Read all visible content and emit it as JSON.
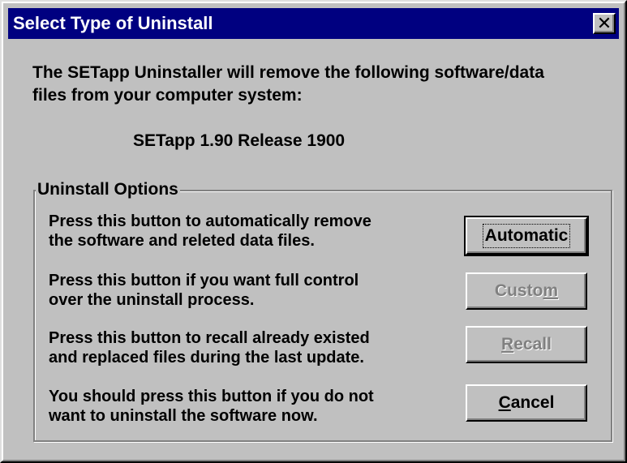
{
  "window": {
    "title": "Select Type of Uninstall",
    "close_glyph": "✕"
  },
  "intro": {
    "line1": "The SETapp Uninstaller will remove the following software/data",
    "line2": "files from your computer system:"
  },
  "product": "SETapp 1.90 Release 1900",
  "group": {
    "legend": "Uninstall Options",
    "options": [
      {
        "desc_line1": "Press this button to automatically remove",
        "desc_line2": "the software and releted data files.",
        "button_label": "Automatic",
        "button_state": "default"
      },
      {
        "desc_line1": "Press this button if you want full control",
        "desc_line2": "over the uninstall process.",
        "button_label_pre": "Custo",
        "button_label_accel": "m",
        "button_label_post": "",
        "button_state": "disabled"
      },
      {
        "desc_line1": "Press this button to recall already existed",
        "desc_line2": "and replaced files during the last update.",
        "button_label_pre": "",
        "button_label_accel": "R",
        "button_label_post": "ecall",
        "button_state": "disabled"
      },
      {
        "desc_line1": "You should press this button if you do not",
        "desc_line2": "want to uninstall the software now.",
        "button_label_pre": "",
        "button_label_accel": "C",
        "button_label_post": "ancel",
        "button_state": "enabled"
      }
    ]
  },
  "colors": {
    "face": "#c0c0c0",
    "titlebar": "#000080",
    "title_text": "#ffffff",
    "disabled_text": "#808080"
  },
  "icons": {
    "close": "close-icon"
  }
}
